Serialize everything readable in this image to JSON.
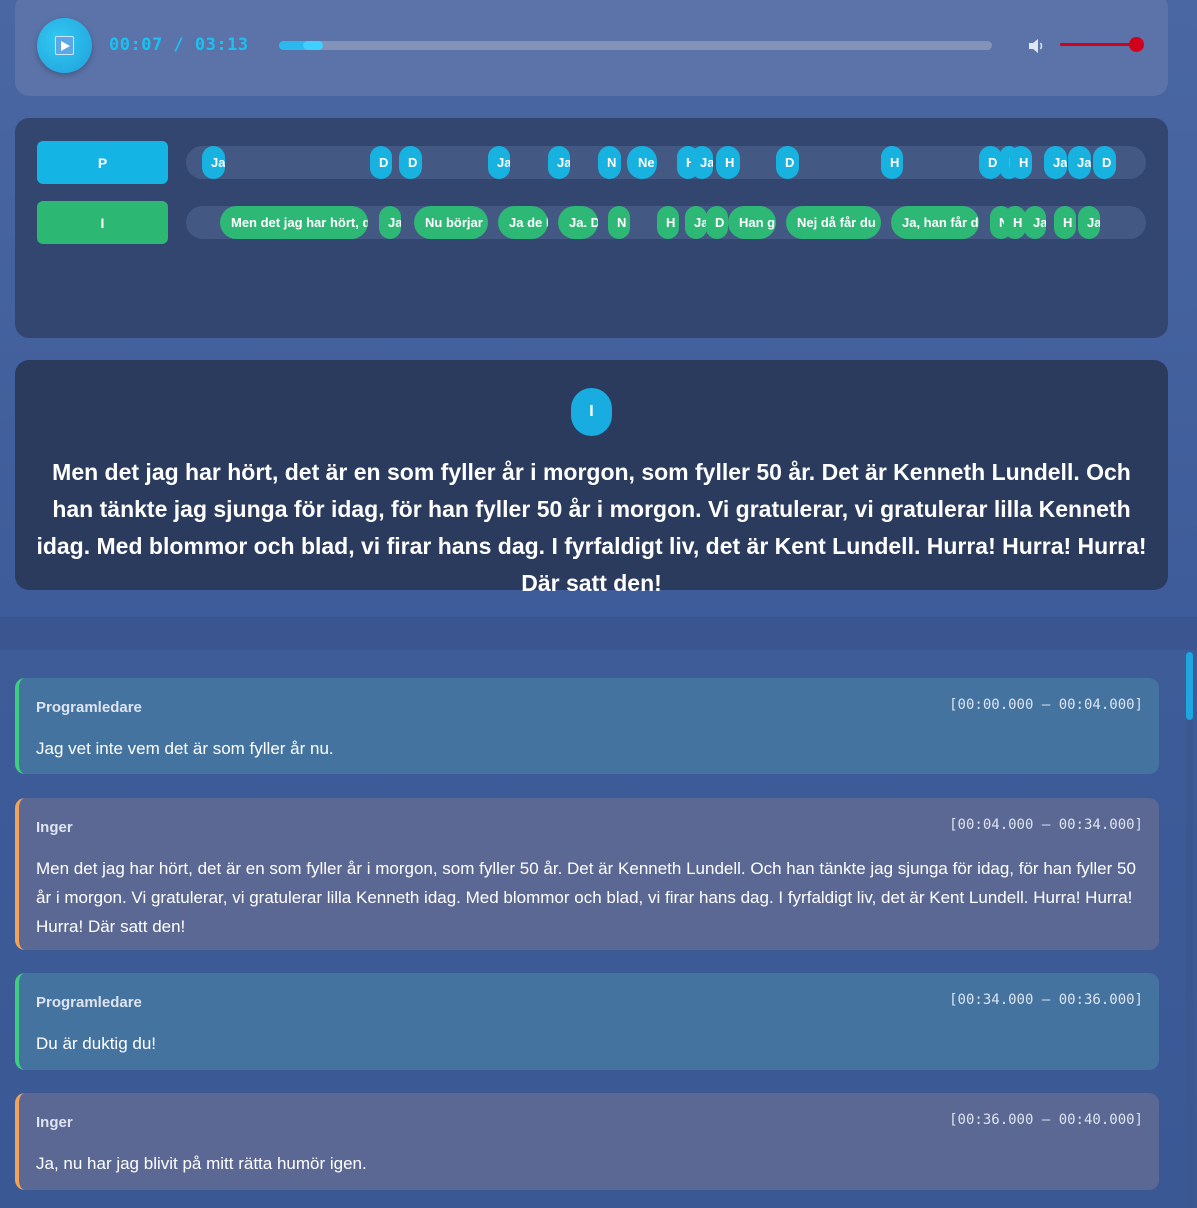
{
  "player": {
    "time_display": "00:07 / 03:13",
    "progress_fraction": 0.036,
    "volume_fraction": 1.0,
    "colors": {
      "accent": "#19c2f0",
      "volume": "#d0021b"
    }
  },
  "timeline": {
    "lanes": [
      {
        "label": "P",
        "color": "#14b4e4",
        "segments": [
          {
            "text": "Ja"
          },
          {
            "text": "D"
          },
          {
            "text": "D"
          },
          {
            "text": "Ja"
          },
          {
            "text": "Ja"
          },
          {
            "text": "N"
          },
          {
            "text": "Ne"
          },
          {
            "text": "H"
          },
          {
            "text": "Ja"
          },
          {
            "text": "H"
          },
          {
            "text": "D"
          },
          {
            "text": "H"
          },
          {
            "text": "D"
          },
          {
            "text": "B"
          },
          {
            "text": "H"
          },
          {
            "text": "Ja"
          },
          {
            "text": "Ja"
          },
          {
            "text": "D"
          }
        ]
      },
      {
        "label": "I",
        "color": "#2cb873",
        "segments": [
          {
            "text": "Men det jag har hört, d"
          },
          {
            "text": "Ja"
          },
          {
            "text": "Nu börjar"
          },
          {
            "text": "Ja de l"
          },
          {
            "text": "Ja. D"
          },
          {
            "text": "N"
          },
          {
            "text": "H"
          },
          {
            "text": "Ja"
          },
          {
            "text": "D"
          },
          {
            "text": "Han g"
          },
          {
            "text": "Nej då får du"
          },
          {
            "text": "Ja, han får d"
          },
          {
            "text": "N"
          },
          {
            "text": "H"
          },
          {
            "text": "Ja"
          },
          {
            "text": "H"
          },
          {
            "text": "Ja"
          }
        ]
      }
    ]
  },
  "current_caption": {
    "speaker": "I",
    "text": "Men det jag har hört, det är en som fyller år i morgon, som fyller 50 år. Det är Kenneth Lundell. Och han tänkte jag sjunga för idag, för han fyller 50 år i morgon. Vi gratulerar, vi gratulerar lilla Kenneth idag. Med blommor och blad, vi firar hans dag. I fyrfaldigt liv, det är Kent Lundell. Hurra! Hurra! Hurra! Där satt den!"
  },
  "transcript": [
    {
      "speaker": "Programledare",
      "time": "[00:00.000 – 00:04.000]",
      "text": "Jag vet inte vem det är som fyller år nu."
    },
    {
      "speaker": "Inger",
      "time": "[00:04.000 – 00:34.000]",
      "text": "Men det jag har hört, det är en som fyller år i morgon, som fyller 50 år. Det är Kenneth Lundell. Och han tänkte jag sjunga för idag, för han fyller 50 år i morgon. Vi gratulerar, vi gratulerar lilla Kenneth idag. Med blommor och blad, vi firar hans dag. I fyrfaldigt liv, det är Kent Lundell. Hurra! Hurra! Hurra! Där satt den!"
    },
    {
      "speaker": "Programledare",
      "time": "[00:34.000 – 00:36.000]",
      "text": "Du är duktig du!"
    },
    {
      "speaker": "Inger",
      "time": "[00:36.000 – 00:40.000]",
      "text": "Ja, nu har jag blivit på mitt rätta humör igen."
    }
  ]
}
